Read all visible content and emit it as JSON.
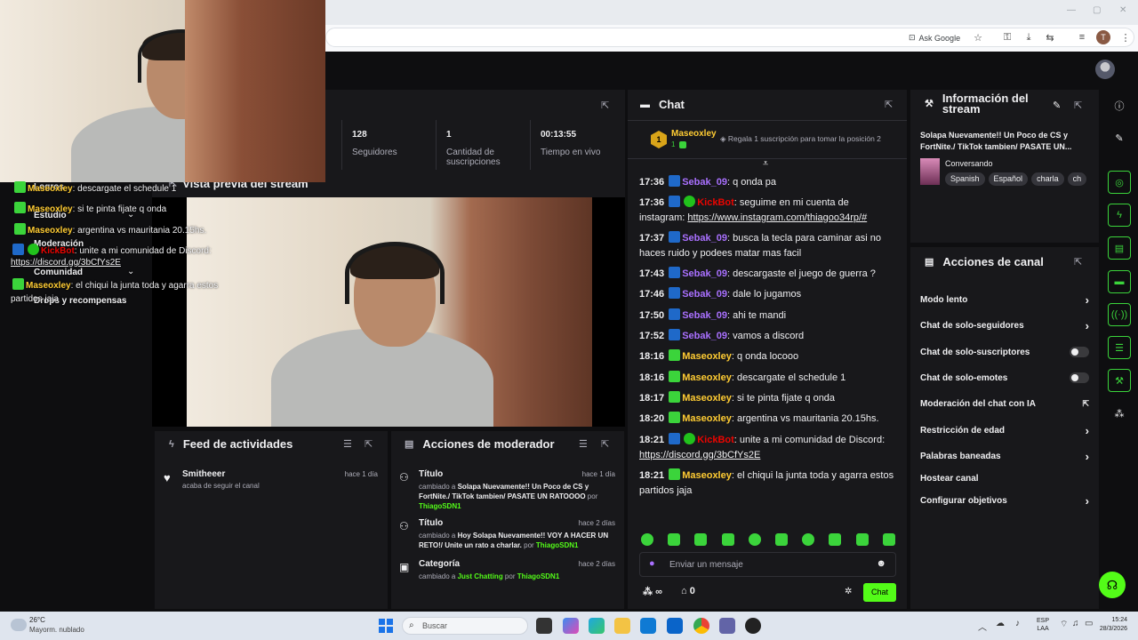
{
  "browser": {
    "ask_google": "Ask Google",
    "profile_letter": "T",
    "window_controls": [
      "—",
      "▢",
      "✕"
    ]
  },
  "stats": [
    {
      "num": "128",
      "label": "Seguidores"
    },
    {
      "num": "1",
      "label": "Cantidad de suscripciones"
    },
    {
      "num": "00:13:55",
      "label": "Tiempo en vivo"
    }
  ],
  "preview_title": "Vista previa del stream",
  "left_nav": {
    "items": [
      "Logros",
      "Estudio",
      "Moderación",
      "Comunidad",
      "Drops y recompensas"
    ]
  },
  "overlay_chat": [
    {
      "user": "Maseoxley",
      "text": ": descargate el schedule 1"
    },
    {
      "user": "Maseoxley",
      "text": ": si te pinta fijate q onda"
    },
    {
      "user": "Maseoxley",
      "text": ": argentina vs mauritania 20.15hs."
    },
    {
      "user": "KickBot",
      "text": ": unite a mi comunidad de Discord:"
    },
    {
      "link": "https://discord.gg/3bCfYs2E"
    },
    {
      "user": "Maseoxley",
      "text": ": el chiqui la junta toda y agarra estos partidos jaja"
    }
  ],
  "chat": {
    "title": "Chat",
    "pinned_user": "Maseoxley",
    "pinned_count": "1",
    "pinned_rank": "1",
    "pinned_text": "Regala 1 suscripción para tomar la posición 2",
    "placeholder": "Enviar un mensaje",
    "send_label": "Chat",
    "infinite": "∞",
    "points": "0",
    "messages": [
      {
        "time": "17:36",
        "user": "Sebak_09",
        "text": ": q onda pa",
        "color": "purple",
        "badge": "blue"
      },
      {
        "time": "17:36",
        "user": "KickBot",
        "text": ": seguime en mi cuenta de instagram: ",
        "link": "https://www.instagram.com/thiagoo34rp/#",
        "color": "red",
        "badge": "both"
      },
      {
        "time": "17:37",
        "user": "Sebak_09",
        "text": ": busca la tecla para caminar asi no haces ruido y podees matar mas facil",
        "color": "purple",
        "badge": "blue"
      },
      {
        "time": "17:43",
        "user": "Sebak_09",
        "text": ": descargaste el juego de guerra ?",
        "color": "purple",
        "badge": "blue"
      },
      {
        "time": "17:46",
        "user": "Sebak_09",
        "text": ": dale lo jugamos",
        "color": "purple",
        "badge": "blue"
      },
      {
        "time": "17:50",
        "user": "Sebak_09",
        "text": ": ahi te mandi",
        "color": "purple",
        "badge": "blue"
      },
      {
        "time": "17:52",
        "user": "Sebak_09",
        "text": ": vamos a discord",
        "color": "purple",
        "badge": "blue"
      },
      {
        "time": "18:16",
        "user": "Maseoxley",
        "text": ": q onda locooo",
        "color": "yellow",
        "badge": "gift"
      },
      {
        "time": "18:16",
        "user": "Maseoxley",
        "text": ": descargate el schedule 1",
        "color": "yellow",
        "badge": "gift"
      },
      {
        "time": "18:17",
        "user": "Maseoxley",
        "text": ": si te pinta fijate q onda",
        "color": "yellow",
        "badge": "gift"
      },
      {
        "time": "18:20",
        "user": "Maseoxley",
        "text": ": argentina vs mauritania 20.15hs.",
        "color": "yellow",
        "badge": "gift"
      },
      {
        "time": "18:21",
        "user": "KickBot",
        "text": ": unite a mi comunidad de Discord: ",
        "link": "https://discord.gg/3bCfYs2E",
        "color": "red",
        "badge": "both"
      },
      {
        "time": "18:21",
        "user": "Maseoxley",
        "text": ": el chiqui la junta toda y agarra estos partidos jaja",
        "color": "yellow",
        "badge": "gift"
      }
    ]
  },
  "stream_info": {
    "title": "Información del stream",
    "stream_title": "Solapa Nuevamente!! Un Poco de CS y FortNite./ TikTok tambien/ PASATE UN...",
    "category": "Conversando",
    "tags": [
      "Spanish",
      "Español",
      "charla",
      "ch"
    ]
  },
  "channel_actions": {
    "title": "Acciones de canal",
    "rows": [
      {
        "label": "Modo lento",
        "control": "chevron"
      },
      {
        "label": "Chat de solo-seguidores",
        "control": "chevron"
      },
      {
        "label": "Chat de solo-suscriptores",
        "control": "toggle"
      },
      {
        "label": "Chat de solo-emotes",
        "control": "toggle"
      },
      {
        "label": "Moderación del chat con IA",
        "control": "external"
      },
      {
        "label": "Restricción de edad",
        "control": "chevron"
      },
      {
        "label": "Palabras baneadas",
        "control": "chevron"
      },
      {
        "label": "Hostear canal",
        "control": "none"
      },
      {
        "label": "Configurar objetivos",
        "control": "chevron"
      }
    ]
  },
  "activity_feed": {
    "title": "Feed de actividades",
    "items": [
      {
        "user": "Smitheeer",
        "desc": "acaba de seguir el canal",
        "time": "hace 1 día"
      }
    ]
  },
  "mod_actions": {
    "title": "Acciones de moderador",
    "items": [
      {
        "kind": "Título",
        "time": "hace 1 día",
        "prefix": "cambiado a ",
        "value": "Solapa Nuevamente!! Un Poco de CS y FortNite./ TikTok tambien/ PASATE UN RATOOOO",
        "by": " por ",
        "mod": "ThiagoSDN1"
      },
      {
        "kind": "Título",
        "time": "hace 2 días",
        "prefix": "cambiado a ",
        "value": "Hoy Solapa Nuevamente!! VOY A HACER UN RETO!/ Unite un rato a charlar.",
        "by": " por ",
        "mod": "ThiagoSDN1"
      },
      {
        "kind": "Categoría",
        "time": "hace 2 días",
        "prefix": "cambiado a ",
        "value": "Just Chatting",
        "by": " por ",
        "mod": "ThiagoSDN1"
      }
    ]
  },
  "taskbar": {
    "weather_temp": "26°C",
    "weather_desc": "Mayorm. nublado",
    "search_placeholder": "Buscar",
    "lang1": "ESP",
    "lang2": "LAA",
    "time": "15:24",
    "date": "28/3/2026"
  },
  "colors": {
    "accent": "#53fc18",
    "bg": "#0e0e10",
    "panel": "#18181b"
  }
}
